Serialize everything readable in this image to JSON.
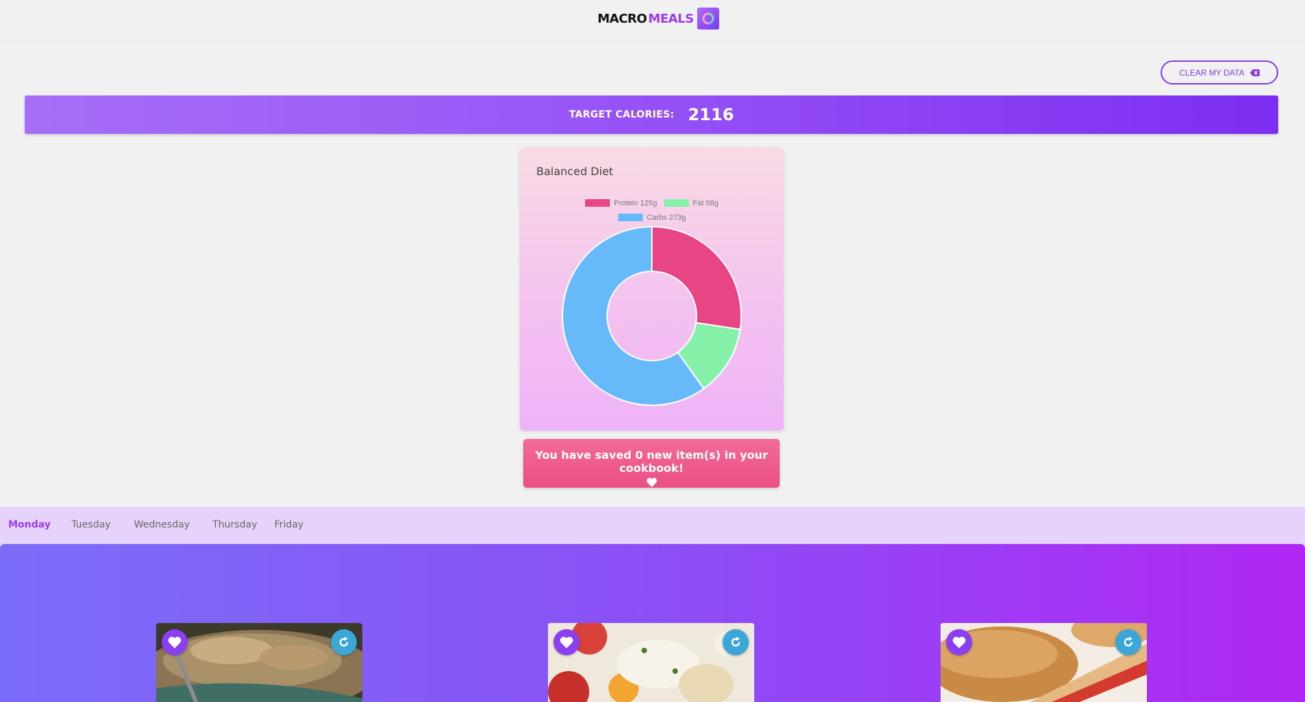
{
  "header": {
    "brand_macro": "MACRO",
    "brand_meals": "MEALS",
    "logo_icon": "macro-ring-icon"
  },
  "clear_button": {
    "label": "CLEAR MY DATA",
    "icon": "backspace-icon"
  },
  "target": {
    "label": "TARGET CALORIES:",
    "value": "2116"
  },
  "chart_card": {
    "title": "Balanced Diet"
  },
  "chart_data": {
    "type": "pie",
    "categories": [
      "Protein 125g",
      "Fat 58g",
      "Carbs 273g"
    ],
    "values": [
      125,
      58,
      273
    ],
    "colors": [
      "#e84585",
      "#85f0a8",
      "#67baf9"
    ],
    "title": "",
    "legend": "top"
  },
  "saved": {
    "text": "You have saved 0 new item(s) in your cookbook!",
    "icon": "heart-icon"
  },
  "days": {
    "active": "Monday",
    "items": [
      "Monday",
      "Tuesday",
      "Wednesday",
      "Thursday",
      "Friday"
    ]
  },
  "meals": [
    {
      "name": "meal-card-1",
      "image": "rice-bowl-image"
    },
    {
      "name": "meal-card-2",
      "image": "pasta-salad-image"
    },
    {
      "name": "meal-card-3",
      "image": "sandwich-image"
    }
  ],
  "colors": {
    "accent": "#9a3bf0",
    "pink": "#ec4f84",
    "blue": "#3ca6d6"
  }
}
